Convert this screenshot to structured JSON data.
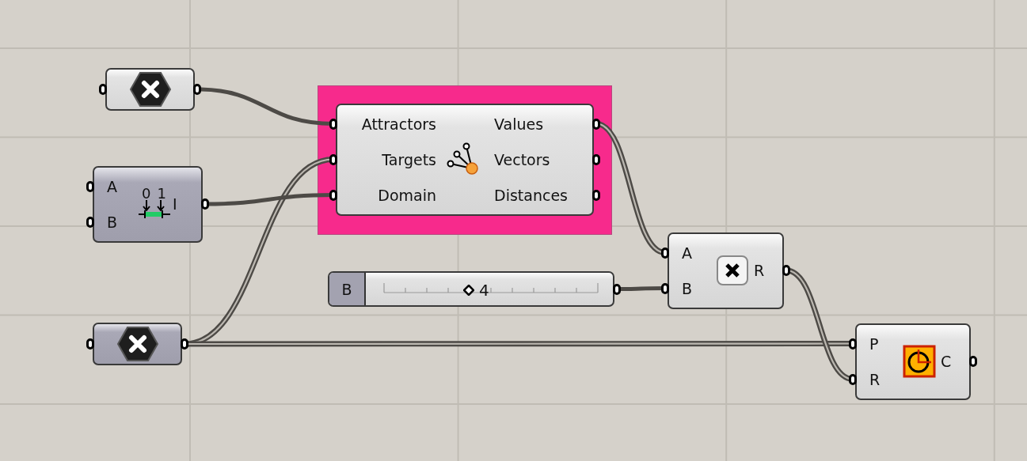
{
  "group": {
    "color": "#f72a8c"
  },
  "nodes": [
    {
      "kind": "param",
      "preview": true
    },
    {
      "kind": "domain",
      "preview": false,
      "inputs": [
        "A",
        "B"
      ],
      "outputs": [
        "I"
      ],
      "icon_labels": [
        "0",
        "1"
      ]
    },
    {
      "kind": "attractor",
      "preview": true,
      "inputs": [
        "Attractors",
        "Targets",
        "Domain"
      ],
      "outputs": [
        "Values",
        "Vectors",
        "Distances"
      ]
    },
    {
      "kind": "slider",
      "label": "B",
      "value": "4",
      "level": 0.4
    },
    {
      "kind": "multiply",
      "preview": true,
      "inputs": [
        "A",
        "B"
      ],
      "outputs": [
        "R"
      ]
    },
    {
      "kind": "param",
      "preview": false
    },
    {
      "kind": "circle",
      "preview": true,
      "inputs": [
        "P",
        "R"
      ],
      "outputs": [
        "C"
      ]
    }
  ]
}
